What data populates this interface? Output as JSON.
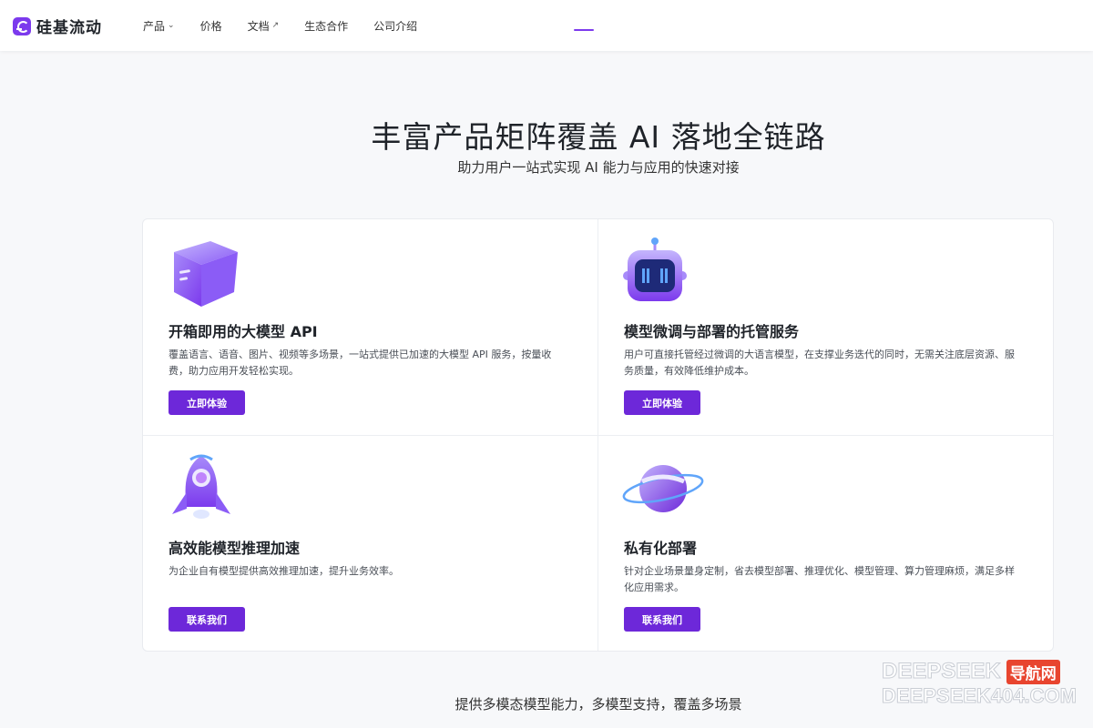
{
  "brand": {
    "name": "硅基流动",
    "accent": "#7c3aed"
  },
  "nav": {
    "items": [
      {
        "label": "产品",
        "icon": "chevron-down-icon"
      },
      {
        "label": "价格"
      },
      {
        "label": "文档",
        "icon": "external-arrow-icon"
      },
      {
        "label": "生态合作"
      },
      {
        "label": "公司介绍"
      }
    ]
  },
  "hero": {
    "title": "丰富产品矩阵覆盖 AI 落地全链路",
    "subtitle": "助力用户一站式实现 AI 能力与应用的快速对接"
  },
  "cards": [
    {
      "title": "开箱即用的大模型 API",
      "desc": "覆盖语言、语音、图片、视频等多场景，一站式提供已加速的大模型 API 服务，按量收费，助力应用开发轻松实现。",
      "button": "立即体验",
      "icon": "cube-icon"
    },
    {
      "title": "模型微调与部署的托管服务",
      "desc": "用户可直接托管经过微调的大语言模型，在支撑业务迭代的同时，无需关注底层资源、服务质量，有效降低维护成本。",
      "button": "立即体验",
      "icon": "robot-icon"
    },
    {
      "title": "高效能模型推理加速",
      "desc": "为企业自有模型提供高效推理加速，提升业务效率。",
      "button": "联系我们",
      "icon": "rocket-icon"
    },
    {
      "title": "私有化部署",
      "desc": "针对企业场景量身定制，省去模型部署、推理优化、模型管理、算力管理麻烦，满足多样化应用需求。",
      "button": "联系我们",
      "icon": "planet-icon"
    }
  ],
  "bottom": {
    "subtitle": "提供多模态模型能力，多模型支持，覆盖多场景"
  },
  "watermark": {
    "line1": "DEEPSEEK",
    "badge": "导航网",
    "line2": "DEEPSEEK404.COM"
  }
}
